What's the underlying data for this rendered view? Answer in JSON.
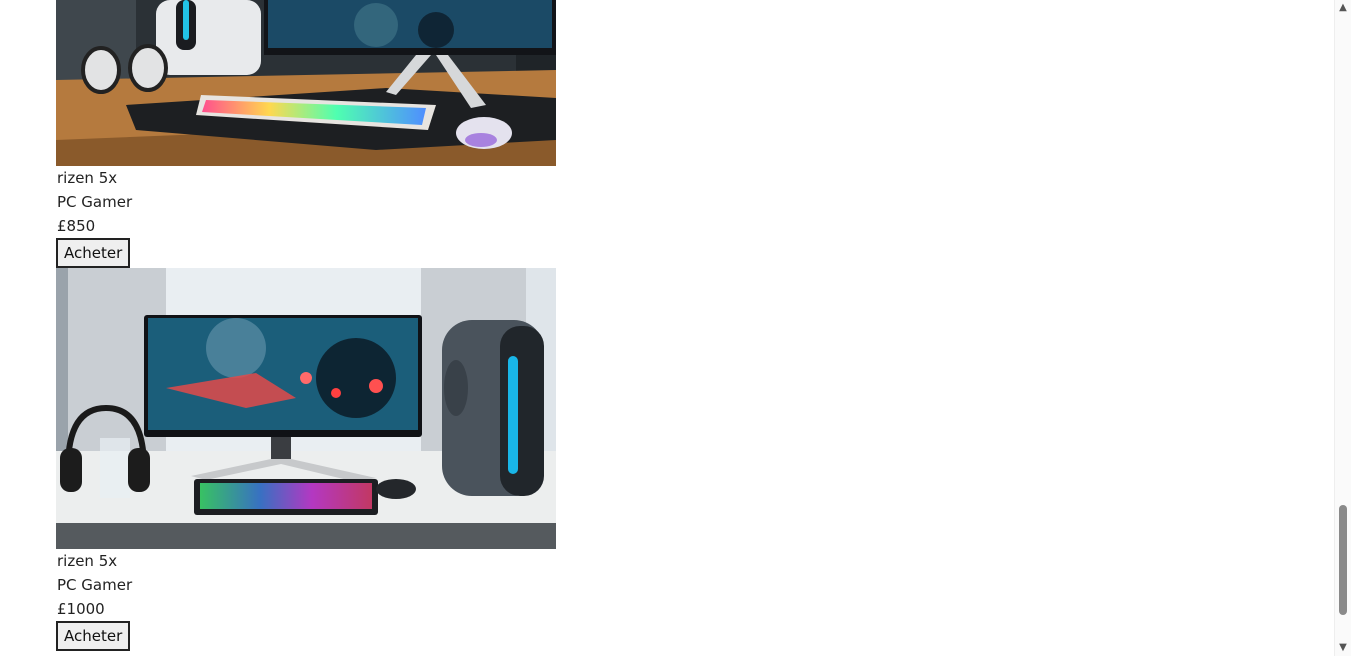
{
  "products": [
    {
      "image_alt": "Gaming desk setup with curved monitor, white tower, RGB keyboard, headphones and mouse",
      "name": "rizen 5x",
      "category": "PC Gamer",
      "price": "£850",
      "button_label": "Acheter"
    },
    {
      "image_alt": "Gaming setup with curved monitor, dark tower with blue light, RGB keyboard, headphones on stand",
      "name": "rizen 5x",
      "category": "PC Gamer",
      "price": "£1000",
      "button_label": "Acheter"
    }
  ],
  "scrollbar": {
    "position_fraction": 0.84
  }
}
